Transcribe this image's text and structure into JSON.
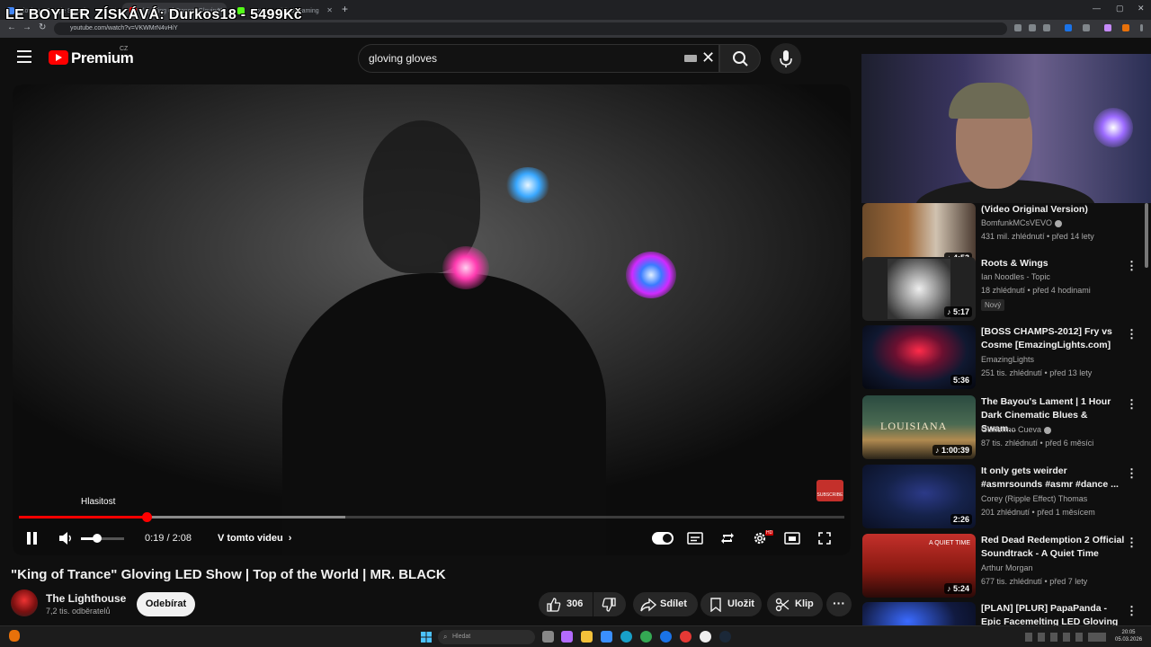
{
  "overlay": {
    "stream_title": "LE BOYLER ZÍSKÁVÁ: Durkos18 - 5499Kč"
  },
  "browser": {
    "tabs": [
      {
        "label": "gloving - Google Search"
      },
      {
        "label": "(1) \"King of Trance\" Gloving..."
      },
      {
        "label": "Browse - Kick Streaming"
      }
    ],
    "url": "youtube.com/watch?v=VKWMrN4vHiY"
  },
  "youtube": {
    "logo_text": "Premium",
    "country_code": "CZ",
    "search": {
      "value": "gloving gloves"
    }
  },
  "player": {
    "volume_tooltip": "Hlasitost",
    "time_display": "0:19 / 2:08",
    "chapter_label": "V tomto videu",
    "progress_played": 0.155,
    "progress_buffered": 0.395,
    "volume_level": 0.37,
    "subscribe_watermark": "SUBSCRIBE"
  },
  "video": {
    "title": "\"King of Trance\" Gloving LED Show | Top of the World | MR. BLACK",
    "channel_name": "The Lighthouse",
    "subscribers": "7,2 tis. odběratelů",
    "subscribe_label": "Odebírat",
    "likes": "306",
    "share_label": "Sdílet",
    "save_label": "Uložit",
    "clip_label": "Klip"
  },
  "related": [
    {
      "title": "(Video Original Version)",
      "channel": "BomfunkMCsVEVO",
      "meta": "431 mil. zhlédnutí • před 14 lety",
      "duration": "4:53",
      "thumb_label": "vevo"
    },
    {
      "title": "Roots & Wings",
      "channel": "Ian Noodles - Topic",
      "meta": "18 zhlédnutí • před 4 hodinami",
      "duration": "5:17",
      "badge": "Nový"
    },
    {
      "title": "[BOSS CHAMPS-2012] Fry vs Cosme [EmazingLights.com]",
      "channel": "EmazingLights",
      "meta": "251 tis. zhlédnutí • před 13 lety",
      "duration": "5:36"
    },
    {
      "title": "The Bayou's Lament | 1 Hour Dark Cinematic Blues & Swam...",
      "channel": "Guillermo Cueva",
      "meta": "87 tis. zhlédnutí • před 6 měsíci",
      "duration": "1:00:39",
      "thumb_label": "LOUISIANA"
    },
    {
      "title": "It only gets weirder #asmrsounds #asmr #dance ...",
      "channel": "Corey (Ripple Effect) Thomas",
      "meta": "201 zhlédnutí • před 1 měsícem",
      "duration": "2:26"
    },
    {
      "title": "Red Dead Redemption 2 Official Soundtrack - A Quiet Time",
      "channel": "Arthur Morgan",
      "meta": "677 tis. zhlédnutí • před 7 lety",
      "duration": "5:24",
      "thumb_label": "A QUIET TIME"
    },
    {
      "title": "[PLAN] [PLUR] PapaPanda - Epic Facemelting LED Gloving light ...",
      "channel": "",
      "meta": "",
      "duration": ""
    }
  ],
  "taskbar": {
    "search_placeholder": "Hledat",
    "time": "20:05",
    "date": "05.03.2026"
  },
  "colors": {
    "accent": "#ff0000",
    "background": "#0f0f0f",
    "text": "#f1f1f1",
    "secondary_text": "#aaaaaa"
  },
  "icons": [
    "menu-icon",
    "youtube-logo-icon",
    "keyboard-icon",
    "clear-icon",
    "search-icon",
    "mic-icon",
    "pause-icon",
    "volume-icon",
    "chevron-right-icon",
    "autoplay-toggle",
    "subtitles-icon",
    "loop-icon",
    "settings-icon",
    "miniplayer-icon",
    "fullscreen-icon",
    "like-icon",
    "dislike-icon",
    "share-icon",
    "save-icon",
    "clip-icon",
    "more-icon",
    "verified-icon",
    "music-note-icon",
    "kebab-icon",
    "windows-start-icon"
  ]
}
